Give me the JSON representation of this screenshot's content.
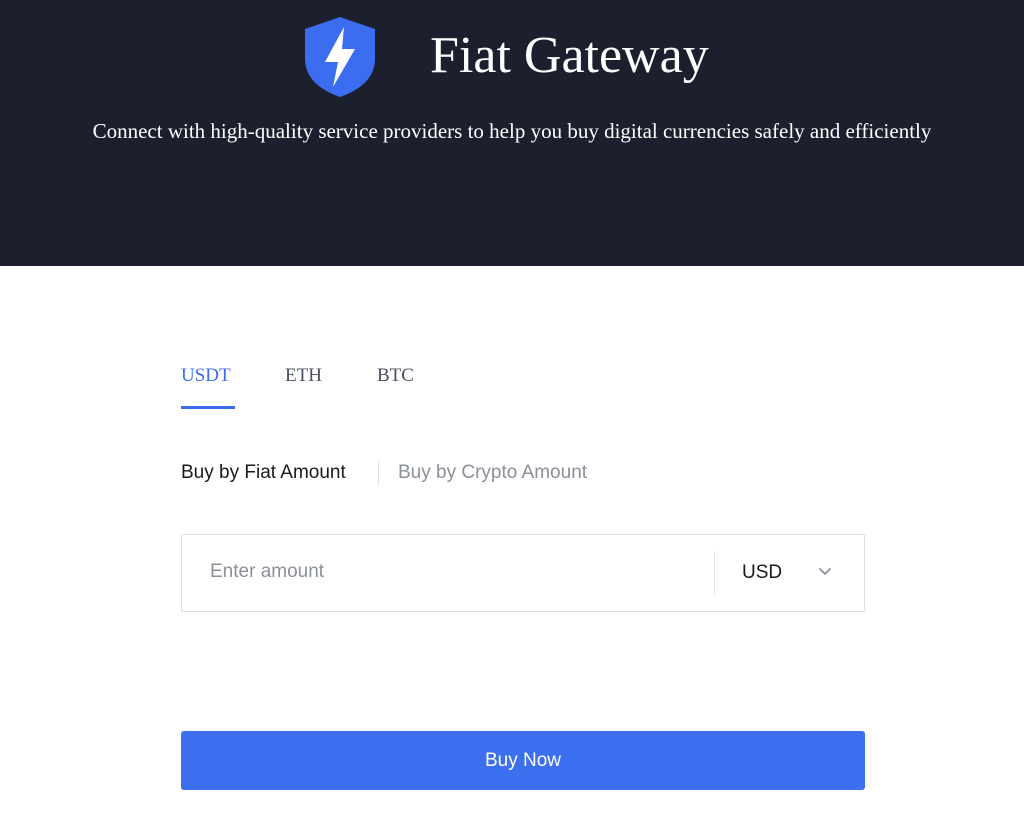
{
  "header": {
    "title": "Fiat Gateway",
    "subtitle": "Connect with high-quality service providers to help you buy digital currencies safely and efficiently",
    "logo_icon": "lightning-shield-icon"
  },
  "tabs": [
    {
      "label": "USDT",
      "active": true
    },
    {
      "label": "ETH",
      "active": false
    },
    {
      "label": "BTC",
      "active": false
    }
  ],
  "buy_modes": [
    {
      "label": "Buy by Fiat Amount",
      "active": true
    },
    {
      "label": "Buy by Crypto Amount",
      "active": false
    }
  ],
  "amount_field": {
    "placeholder": "Enter amount",
    "value": "",
    "currency": "USD",
    "dropdown_icon": "chevron-down-icon"
  },
  "buy_button": {
    "label": "Buy Now"
  },
  "colors": {
    "header_bg": "#1c1f2e",
    "accent": "#3b6ff0",
    "text_primary": "#1a1a1a",
    "text_muted": "#8a8f9a"
  }
}
